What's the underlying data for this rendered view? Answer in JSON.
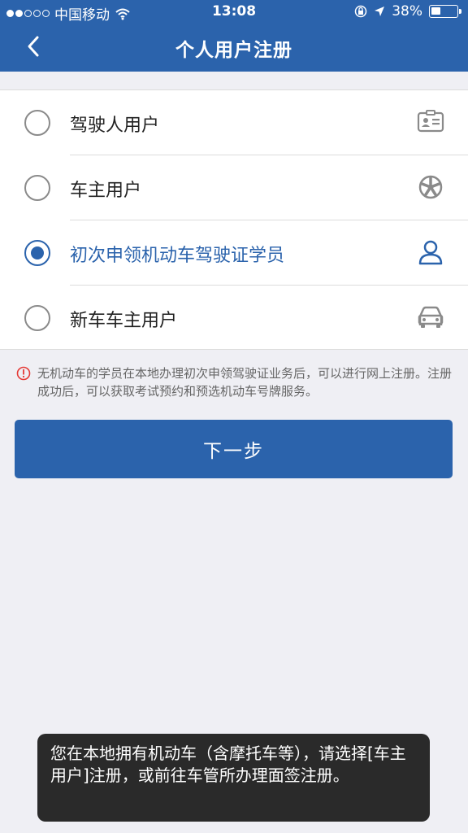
{
  "status_bar": {
    "carrier": "中国移动",
    "time": "13:08",
    "battery_percent": "38%",
    "battery_level": 0.38,
    "signal_strength": 2
  },
  "nav": {
    "back_icon": "chevron-left-icon",
    "title": "个人用户注册"
  },
  "options": [
    {
      "label": "驾驶人用户",
      "icon": "id-card-icon",
      "selected": false
    },
    {
      "label": "车主用户",
      "icon": "wheel-icon",
      "selected": false
    },
    {
      "label": "初次申领机动车驾驶证学员",
      "icon": "person-icon",
      "selected": true
    },
    {
      "label": "新车车主用户",
      "icon": "car-icon",
      "selected": false
    }
  ],
  "notice": {
    "icon": "info-icon",
    "text": "无机动车的学员在本地办理初次申领驾驶证业务后，可以进行网上注册。注册成功后，可以获取考试预约和预选机动车号牌服务。"
  },
  "next_button": {
    "label": "下一步"
  },
  "toast": {
    "text": "您在本地拥有机动车（含摩托车等），请选择[车主用户]注册，或前往车管所办理面签注册。"
  },
  "colors": {
    "primary": "#2b63ac",
    "background": "#efeff4",
    "toast_bg": "#2a2a2a",
    "notice_icon": "#e53935"
  }
}
